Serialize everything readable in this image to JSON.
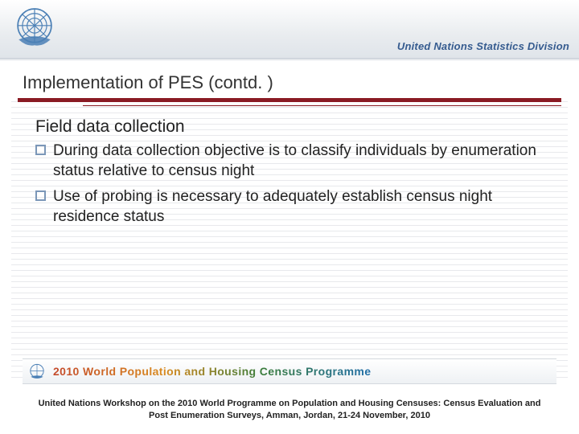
{
  "header": {
    "division_label": "United Nations Statistics Division"
  },
  "title": "Implementation of PES (contd. )",
  "section_heading": "Field data collection",
  "bullets": [
    "During data collection objective is to classify individuals by enumeration status relative to census night",
    "Use of probing is necessary to adequately establish census night residence status"
  ],
  "banner_text": "2010 World Population and Housing Census Programme",
  "footnote": "United Nations Workshop on the 2010 World Programme on Population and Housing Censuses: Census Evaluation and Post Enumeration Surveys, Amman, Jordan, 21-24 November, 2010"
}
